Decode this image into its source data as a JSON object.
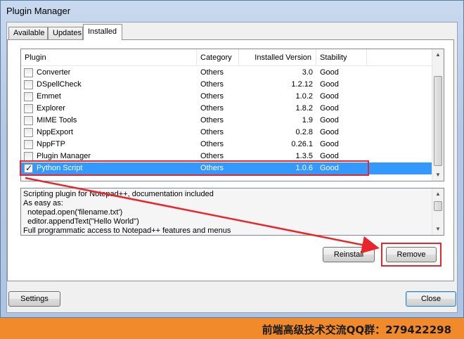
{
  "window": {
    "title": "Plugin Manager"
  },
  "tabs": [
    {
      "label": "Available",
      "active": false
    },
    {
      "label": "Updates",
      "active": false
    },
    {
      "label": "Installed",
      "active": true
    }
  ],
  "list": {
    "columns": [
      "Plugin",
      "Category",
      "Installed Version",
      "Stability"
    ],
    "rows": [
      {
        "checked": false,
        "name": "Converter",
        "category": "Others",
        "version": "3.0",
        "stability": "Good"
      },
      {
        "checked": false,
        "name": "DSpellCheck",
        "category": "Others",
        "version": "1.2.12",
        "stability": "Good"
      },
      {
        "checked": false,
        "name": "Emmet",
        "category": "Others",
        "version": "1.0.2",
        "stability": "Good"
      },
      {
        "checked": false,
        "name": "Explorer",
        "category": "Others",
        "version": "1.8.2",
        "stability": "Good"
      },
      {
        "checked": false,
        "name": "MIME Tools",
        "category": "Others",
        "version": "1.9",
        "stability": "Good"
      },
      {
        "checked": false,
        "name": "NppExport",
        "category": "Others",
        "version": "0.2.8",
        "stability": "Good"
      },
      {
        "checked": false,
        "name": "NppFTP",
        "category": "Others",
        "version": "0.26.1",
        "stability": "Good"
      },
      {
        "checked": false,
        "name": "Plugin Manager",
        "category": "Others",
        "version": "1.3.5",
        "stability": "Good"
      },
      {
        "checked": true,
        "name": "Python Script",
        "category": "Others",
        "version": "1.0.6",
        "stability": "Good",
        "selected": true
      }
    ]
  },
  "description": {
    "lines": [
      "Scripting plugin for Notepad++, documentation included",
      "As easy as:",
      "  notepad.open('filename.txt')",
      "  editor.appendText(\"Hello World\")",
      "Full programmatic access to Notepad++ features and menus"
    ]
  },
  "buttons": {
    "reinstall": "Reinstall",
    "remove": "Remove",
    "settings": "Settings",
    "close": "Close"
  },
  "banner": {
    "text": "前端高级技术交流QQ群：279422298"
  },
  "colors": {
    "selection": "#3399ff",
    "annotation": "#e8262b",
    "banner": "#f08a2a"
  }
}
